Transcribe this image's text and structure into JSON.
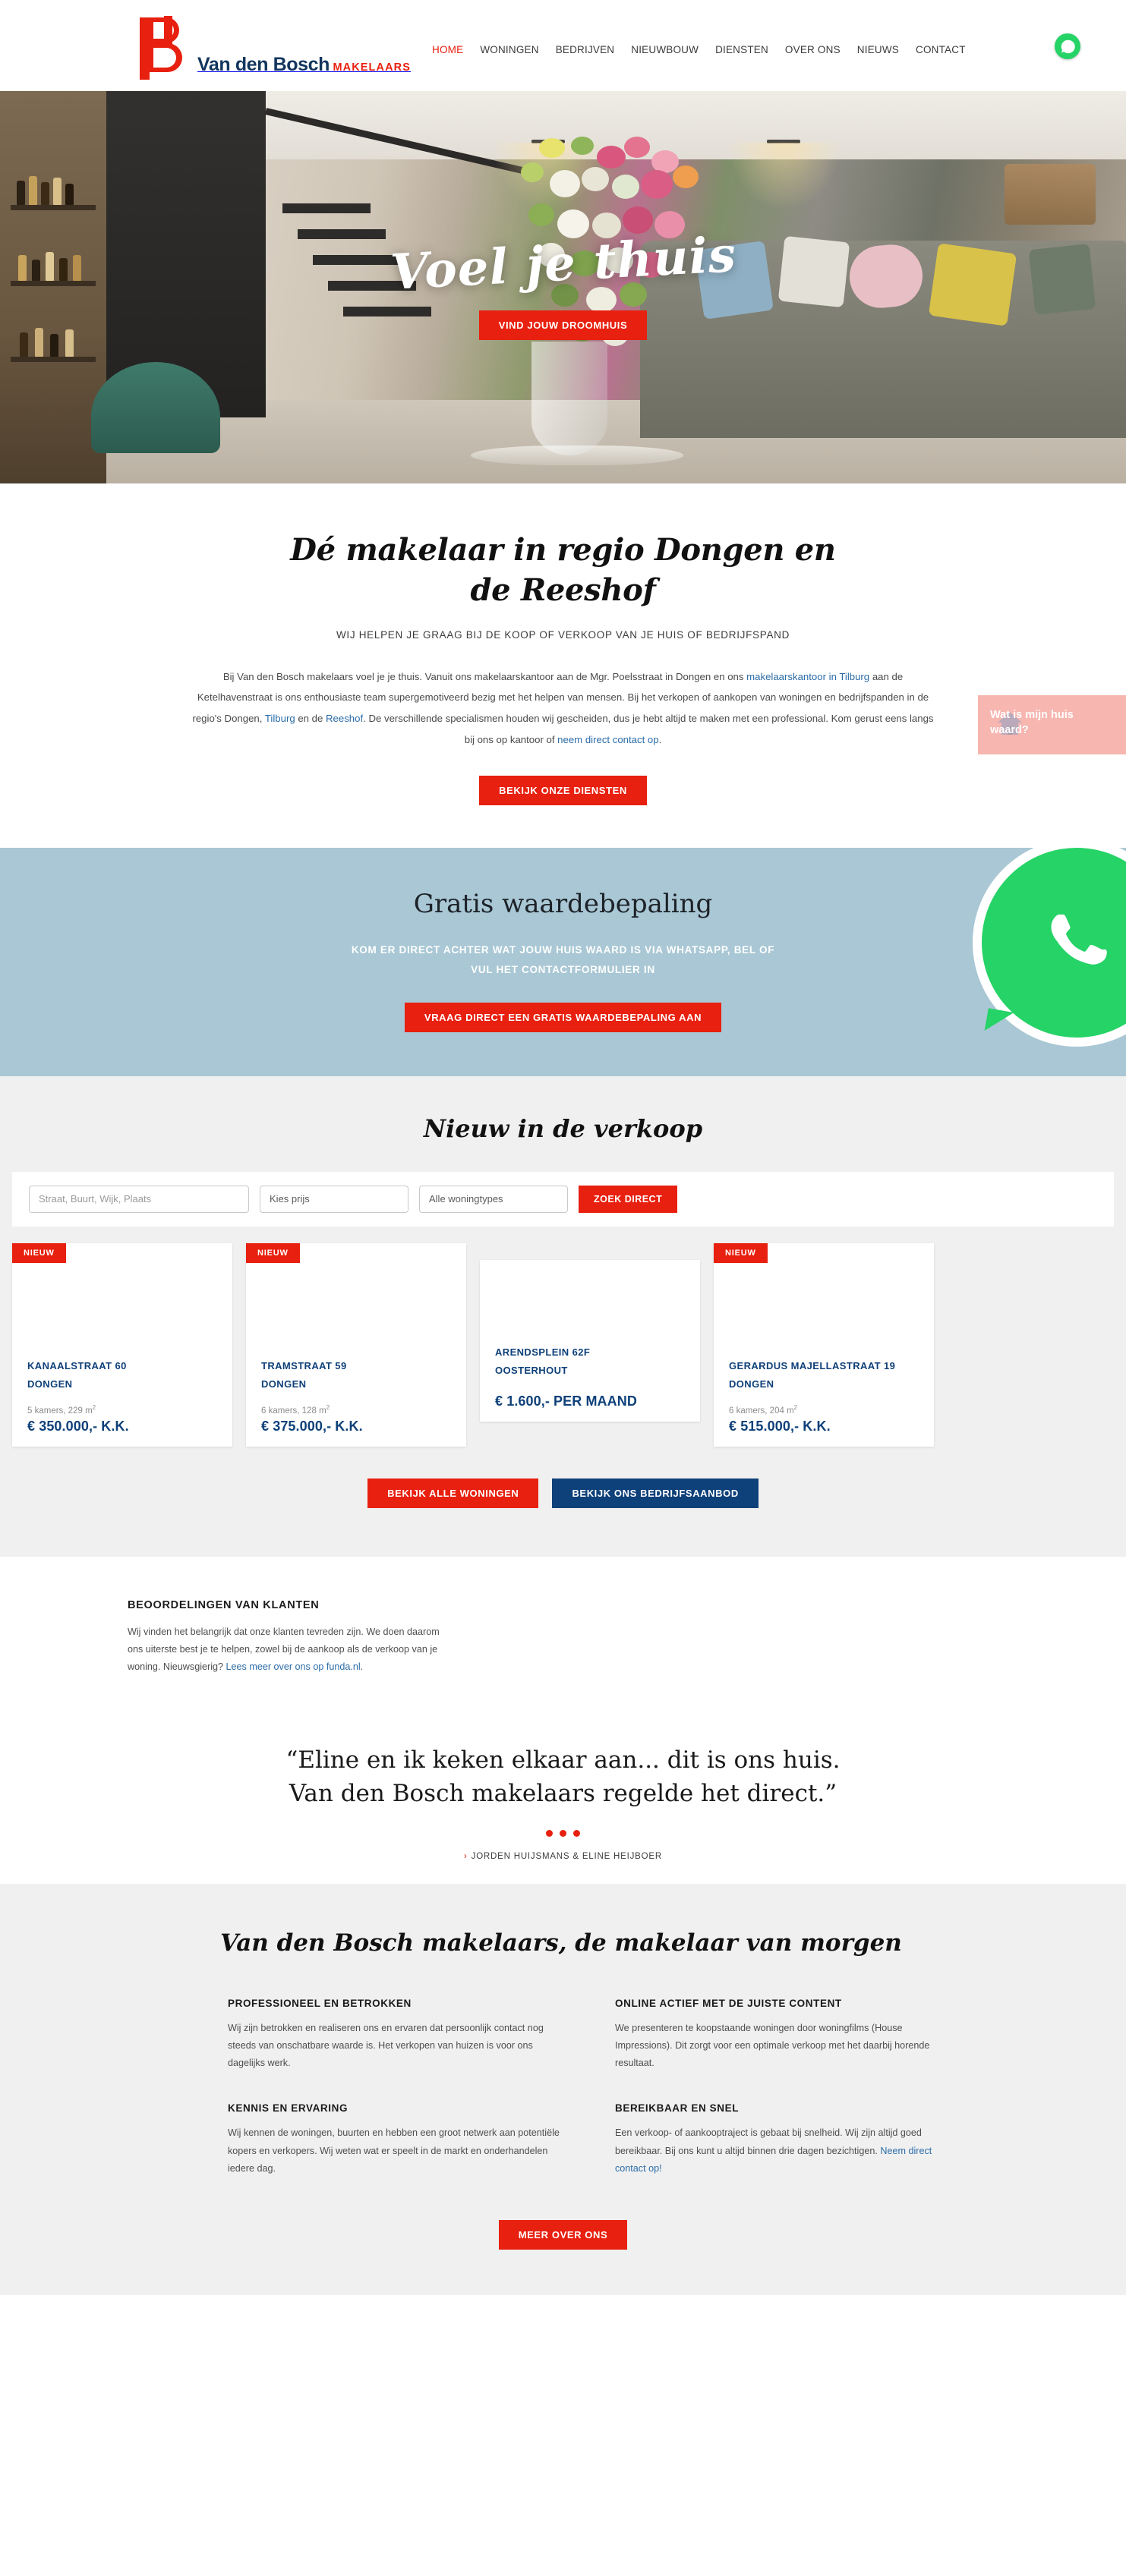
{
  "brand": {
    "logo_name": "Van den Bosch",
    "logo_sub": "MAKELAARS",
    "accent_red": "#e8200f",
    "accent_navy": "#0e4079",
    "whatsapp_green": "#25d366",
    "waarde_blue": "#a9c7d4"
  },
  "nav": {
    "items": [
      {
        "label": "HOME",
        "active": true
      },
      {
        "label": "WONINGEN",
        "active": false
      },
      {
        "label": "BEDRIJVEN",
        "active": false
      },
      {
        "label": "NIEUWBOUW",
        "active": false
      },
      {
        "label": "DIENSTEN",
        "active": false
      },
      {
        "label": "OVER ONS",
        "active": false
      },
      {
        "label": "NIEUWS",
        "active": false
      },
      {
        "label": "CONTACT",
        "active": false
      }
    ],
    "whatsapp_icon": "whatsapp-icon"
  },
  "hero": {
    "script_text": "Voel je thuis",
    "cta_label": "VIND JOUW DROOMHUIS"
  },
  "intro": {
    "heading": "Dé makelaar in regio Dongen en de Reeshof",
    "subheading": "WIJ HELPEN JE GRAAG BIJ DE KOOP OF VERKOOP VAN JE HUIS OF BEDRIJFSPAND",
    "body_part1": "Bij Van den Bosch makelaars voel je je thuis. Vanuit ons makelaarskantoor aan de Mgr. Poelsstraat in Dongen en ons ",
    "link1": "makelaarskantoor in Tilburg",
    "body_part2": " aan de Ketelhavenstraat is ons enthousiaste team supergemotiveerd bezig met het helpen van mensen. Bij het verkopen of aankopen van woningen en bedrijfspanden in de regio's Dongen, ",
    "link2": "Tilburg",
    "body_part3": " en de ",
    "link3": "Reeshof",
    "body_part4": ". De verschillende specialismen houden wij gescheiden, dus je hebt altijd te maken met een professional. Kom gerust eens langs bij ons op kantoor of ",
    "link4": "neem direct contact op",
    "body_part5": ".",
    "cta_label": "BEKIJK ONZE DIENSTEN"
  },
  "waarde": {
    "heading": "Gratis waardebepaling",
    "subtext": "KOM ER DIRECT ACHTER WAT JOUW HUIS WAARD IS VIA WHATSAPP, BEL OF VUL HET CONTACTFORMULIER IN",
    "cta_label": "VRAAG DIRECT EEN GRATIS WAARDEBEPALING AAN",
    "icon": "whatsapp-icon"
  },
  "listings": {
    "heading": "Nieuw in de verkoop",
    "search": {
      "location_placeholder": "Straat, Buurt, Wijk, Plaats",
      "location_value": "",
      "price_label": "Kies prijs",
      "type_label": "Alle woningtypes",
      "submit_label": "ZOEK DIRECT"
    },
    "cards": [
      {
        "badge": "NIEUW",
        "street": "KANAALSTRAAT 60",
        "city": "DONGEN",
        "meta_rooms": "5 kamers, 229 m",
        "meta_sup": "2",
        "price": "€ 350.000,- K.K."
      },
      {
        "badge": "NIEUW",
        "street": "TRAMSTRAAT 59",
        "city": "DONGEN",
        "meta_rooms": "6 kamers, 128 m",
        "meta_sup": "2",
        "price": "€ 375.000,- K.K."
      },
      {
        "badge": "",
        "street": "ARENDSPLEIN 62F",
        "city": "OOSTERHOUT",
        "meta_rooms": "",
        "meta_sup": "",
        "price": "€ 1.600,- PER MAAND"
      },
      {
        "badge": "NIEUW",
        "street": "GERARDUS MAJELLASTRAAT 19",
        "city": "DONGEN",
        "meta_rooms": "6 kamers, 204 m",
        "meta_sup": "2",
        "price": "€ 515.000,- K.K."
      }
    ],
    "btn_all_homes": "BEKIJK ALLE WONINGEN",
    "btn_business": "BEKIJK ONS BEDRIJFSAANBOD"
  },
  "reviews": {
    "heading": "BEOORDELINGEN VAN KLANTEN",
    "body_part1": "Wij vinden het belangrijk dat onze klanten tevreden zijn. We doen daarom ons uiterste best je te helpen, zowel bij de aankoop als de verkoop van je woning. Nieuwsgierig? ",
    "link": "Lees meer over ons op funda.nl",
    "body_part2": ".",
    "quote": "“Eline en ik keken elkaar aan... dit is ons huis. Van den Bosch makelaars regelde het direct.”",
    "author": "JORDEN HUIJSMANS & ELINE HEIJBOER",
    "author_chevron": "›",
    "dot_count": 3
  },
  "features": {
    "heading": "Van den Bosch makelaars, de makelaar van morgen",
    "columns": [
      {
        "title": "PROFESSIONEEL EN BETROKKEN",
        "body": "Wij zijn betrokken en realiseren ons en ervaren dat persoonlijk contact nog steeds van onschatbare waarde is. Het verkopen van huizen is voor ons dagelijks werk.",
        "link": "",
        "body_tail": ""
      },
      {
        "title": "ONLINE ACTIEF MET DE JUISTE CONTENT",
        "body": "We presenteren te koopstaande woningen door woningfilms (House Impressions). Dit zorgt voor een optimale verkoop met het daarbij horende resultaat.",
        "link": "",
        "body_tail": ""
      },
      {
        "title": "KENNIS EN ERVARING",
        "body": "Wij kennen de woningen, buurten en hebben een groot netwerk aan potentiële kopers en verkopers. Wij weten wat er speelt in de markt en onderhandelen iedere dag.",
        "link": "",
        "body_tail": ""
      },
      {
        "title": "BEREIKBAAR EN SNEL",
        "body": "Een verkoop- of aankooptraject is gebaat bij snelheid. Wij zijn altijd goed bereikbaar. Bij ons kunt u altijd binnen drie dagen bezichtigen. ",
        "link": "Neem direct contact op!",
        "body_tail": ""
      }
    ],
    "cta_label": "MEER OVER ONS"
  },
  "chat_widget": {
    "text": "Wat is mijn huis waard?",
    "close_icon": "close-icon",
    "house_icon": "house-icon"
  }
}
